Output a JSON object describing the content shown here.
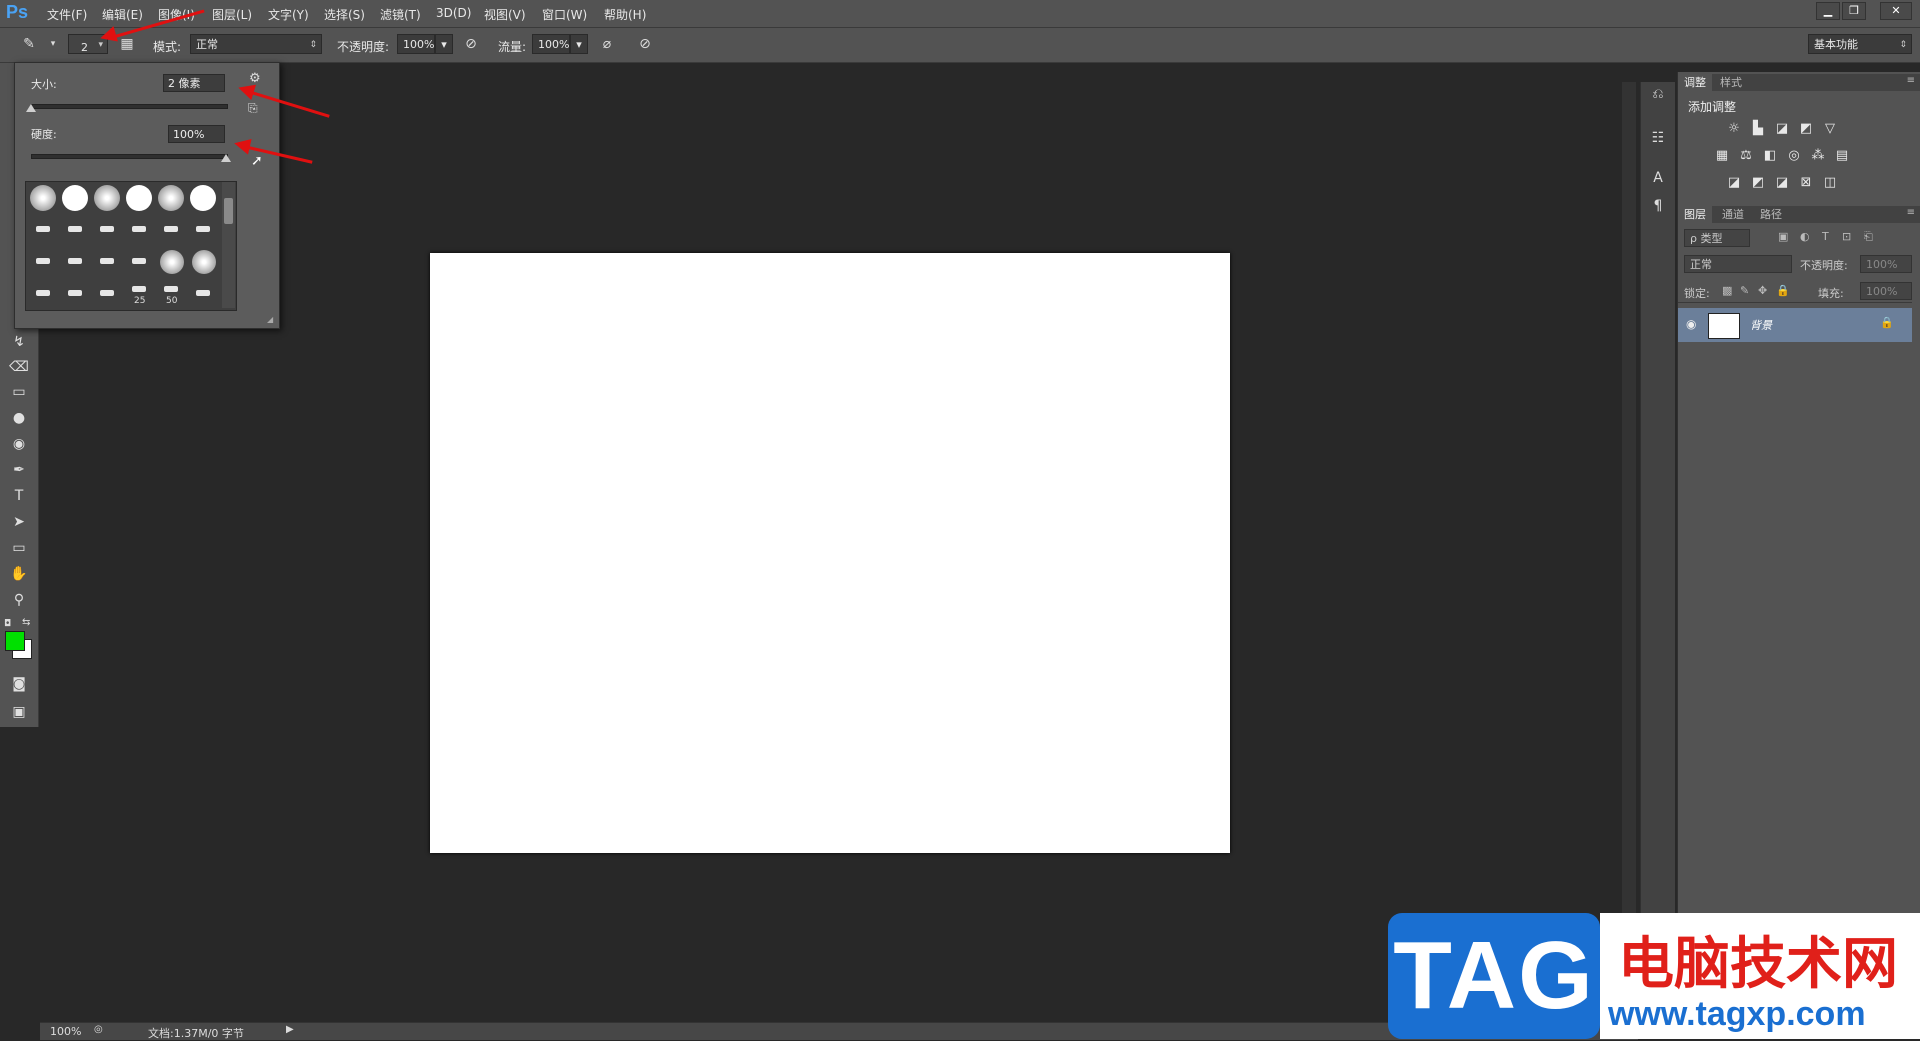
{
  "app": {
    "logo": "Ps"
  },
  "menu": {
    "items": [
      "文件(F)",
      "编辑(E)",
      "图像(I)",
      "图层(L)",
      "文字(Y)",
      "选择(S)",
      "滤镜(T)",
      "3D(D)",
      "视图(V)",
      "窗口(W)",
      "帮助(H)"
    ]
  },
  "window_controls": {
    "minimize": "▁",
    "restore": "❐",
    "close": "✕"
  },
  "options_bar": {
    "brush_size": "2",
    "mode_label": "模式:",
    "mode_value": "正常",
    "opacity_label": "不透明度:",
    "opacity_value": "100%",
    "flow_label": "流量:",
    "flow_value": "100%",
    "workspace": "基本功能"
  },
  "brush_popup": {
    "size_label": "大小:",
    "size_value": "2 像素",
    "size_fraction": 0.0,
    "hardness_label": "硬度:",
    "hardness_value": "100%",
    "hardness_fraction": 1.0,
    "brush_numbers": [
      "25",
      "50"
    ]
  },
  "status_bar": {
    "zoom": "100%",
    "doc_info": "文档:1.37M/0 字节"
  },
  "adjustments_panel": {
    "tabs": [
      "调整",
      "样式"
    ],
    "title": "添加调整"
  },
  "layers_panel": {
    "tabs": [
      "图层",
      "通道",
      "路径"
    ],
    "filter_label": "ρ 类型",
    "blend_mode": "正常",
    "opacity_label": "不透明度:",
    "opacity_value": "100%",
    "lock_label": "锁定:",
    "fill_label": "填充:",
    "fill_value": "100%",
    "layers": [
      {
        "name": "背景"
      }
    ]
  },
  "colors": {
    "foreground": "#00e000",
    "background": "#ffffff",
    "annotation": "#e01010"
  },
  "watermark": {
    "tag": "TAG",
    "site_name": "电脑技术网",
    "url": "www.tagxp.com"
  }
}
